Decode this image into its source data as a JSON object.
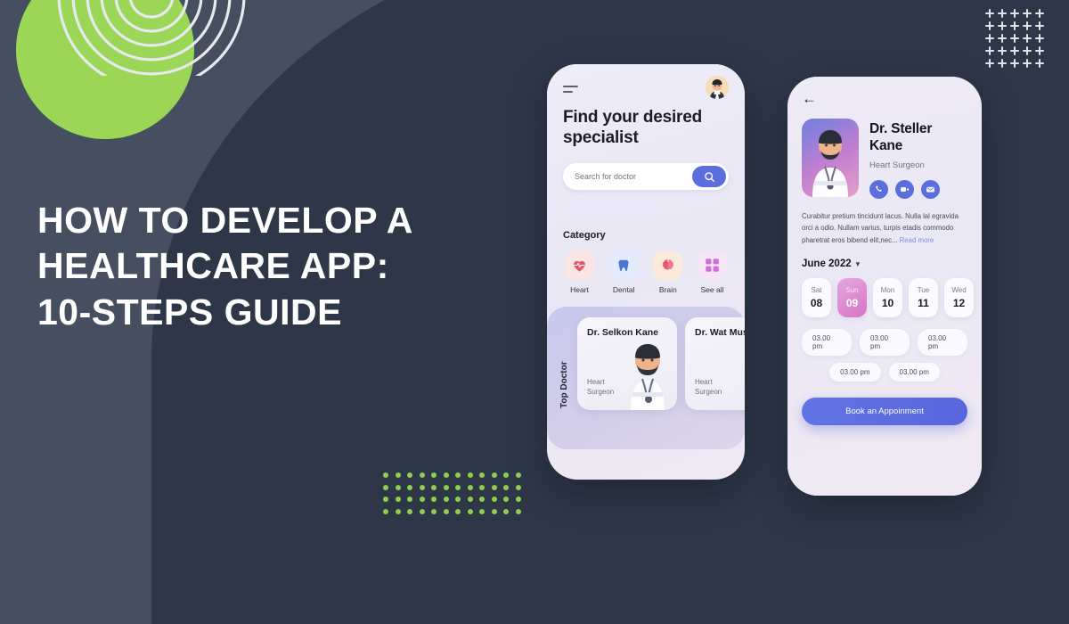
{
  "headline": {
    "line1": "HOW TO DEVELOP A",
    "line2": "HEALTHCARE APP:",
    "line3": "10-STEPS GUIDE"
  },
  "colors": {
    "bg_light": "#454f5f",
    "bg_dark": "#2d3748",
    "green": "#9cd656",
    "accent_blue": "#5b6ede",
    "accent_pink": "#d973c4"
  },
  "phone1": {
    "title": "Find your desired specialist",
    "search": {
      "placeholder": "Search for doctor",
      "value": ""
    },
    "category_title": "Category",
    "categories": [
      {
        "label": "Heart",
        "icon": "heart-icon"
      },
      {
        "label": "Dental",
        "icon": "tooth-icon"
      },
      {
        "label": "Brain",
        "icon": "brain-icon"
      },
      {
        "label": "See all",
        "icon": "grid-icon"
      }
    ],
    "top_doctor_label": "Top Doctor",
    "doctors": [
      {
        "name": "Dr. Selkon Kane",
        "role": "Heart\nSurgeon"
      },
      {
        "name": "Dr. Wat Mushe",
        "role": "Heart\nSurgeon"
      }
    ]
  },
  "phone2": {
    "back_icon": "back-arrow-icon",
    "doctor": {
      "name": "Dr. Steller Kane",
      "role": "Heart Surgeon",
      "actions": [
        {
          "icon": "phone-icon"
        },
        {
          "icon": "video-icon"
        },
        {
          "icon": "mail-icon"
        }
      ]
    },
    "bio": "Curabitur pretium tincidunt lacus. Nulla lal egravida orci a odio. Nullam varius, turpis etadis commodo pharetrat eros bibend elit,nec...",
    "read_more": "Read more",
    "month": "June 2022",
    "days": [
      {
        "name": "Sat",
        "num": "08",
        "selected": false
      },
      {
        "name": "Sun",
        "num": "09",
        "selected": true
      },
      {
        "name": "Mon",
        "num": "10",
        "selected": false
      },
      {
        "name": "Tue",
        "num": "11",
        "selected": false
      },
      {
        "name": "Wed",
        "num": "12",
        "selected": false
      }
    ],
    "slots_row1": [
      "03.00 pm",
      "03.00 pm",
      "03.00 pm"
    ],
    "slots_row2": [
      "03.00 pm",
      "03.00 pm"
    ],
    "book_label": "Book an Appoinment"
  }
}
